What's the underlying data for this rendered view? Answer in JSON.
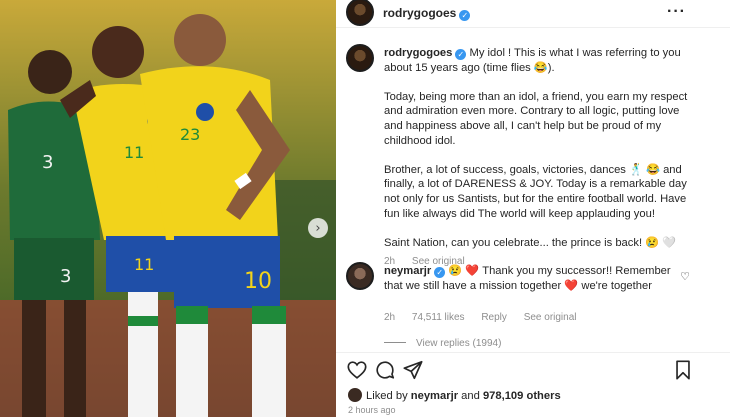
{
  "post": {
    "author": "rodrygogoes",
    "verified": true,
    "more_icon": "more-horizontal-icon"
  },
  "caption": {
    "user": "rodrygogoes",
    "paragraphs": [
      "My idol ! This is what I was referring to you about 15 years ago (time flies 😂).",
      "Today, being more than an idol, a friend, you earn my respect and admiration even more. Contrary to all logic, putting love and happiness above all, I can't help but be proud of my childhood idol.",
      "Brother, a lot of success, goals, victories, dances 🕺 😂 and finally, a lot of DARENESS & JOY. Today is a remarkable day not only for us Santists, but for the entire football world. Have fun like always did The world will keep applauding you!",
      "Saint Nation, can you celebrate... the prince is back! 😢 🤍"
    ],
    "time": "2h",
    "see_original": "See original"
  },
  "comment": {
    "user": "neymarjr",
    "text": "😢 ❤️ Thank you my successor!! Remember that we still have a mission together ❤️ we're together",
    "time": "2h",
    "likes": "74,511 likes",
    "reply": "Reply",
    "see_original": "See original",
    "view_replies": "View replies (1994)"
  },
  "actions": {
    "like_icon": "heart-icon",
    "comment_icon": "comment-icon",
    "share_icon": "send-icon",
    "save_icon": "bookmark-icon"
  },
  "likes_summary": {
    "prefix": "Liked by",
    "user": "neymarjr",
    "conjunction": "and",
    "others": "978,109 others"
  },
  "posted": "2 hours ago",
  "colors": {
    "verified": "#3897f0",
    "jersey_yellow": "#f2d31b",
    "jersey_blue": "#1f4fa8",
    "opponent_green": "#1f6b3a"
  }
}
